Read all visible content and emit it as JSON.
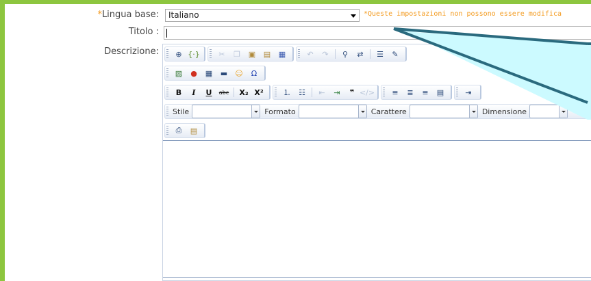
{
  "form": {
    "lingua_label": "Lingua base:",
    "lingua_required": "*",
    "lingua_value": "Italiano",
    "warning": "*Queste impostazioni non possono essere modifica",
    "titolo_label": "Titolo :",
    "descrizione_label": "Descrizione:"
  },
  "toolbar": {
    "row1_icons": [
      "source-icon",
      "template-icon",
      "cut-icon",
      "copy-icon",
      "paste-icon",
      "paste-text-icon",
      "paste-word-icon",
      "undo-icon",
      "redo-icon",
      "find-icon",
      "replace-icon",
      "select-all-icon",
      "remove-format-icon"
    ],
    "row2_icons": [
      "image-icon",
      "flash-icon",
      "table-icon",
      "horizontal-rule-icon",
      "smiley-icon",
      "special-char-icon"
    ],
    "row3": {
      "bold": "B",
      "italic": "I",
      "underline": "U",
      "strike": "abc",
      "subscript": "X₂",
      "superscript": "X²",
      "quote": "❞"
    },
    "row4": {
      "stile": "Stile",
      "formato": "Formato",
      "carattere": "Carattere",
      "dimensione": "Dimensione"
    },
    "row5_icons": [
      "preview-icon",
      "templates-icon"
    ]
  },
  "colors": {
    "frame": "#8dc63f",
    "warning": "#f39a1e",
    "callout_fill": "#ccfaff",
    "callout_stroke": "#2a6a7e"
  }
}
